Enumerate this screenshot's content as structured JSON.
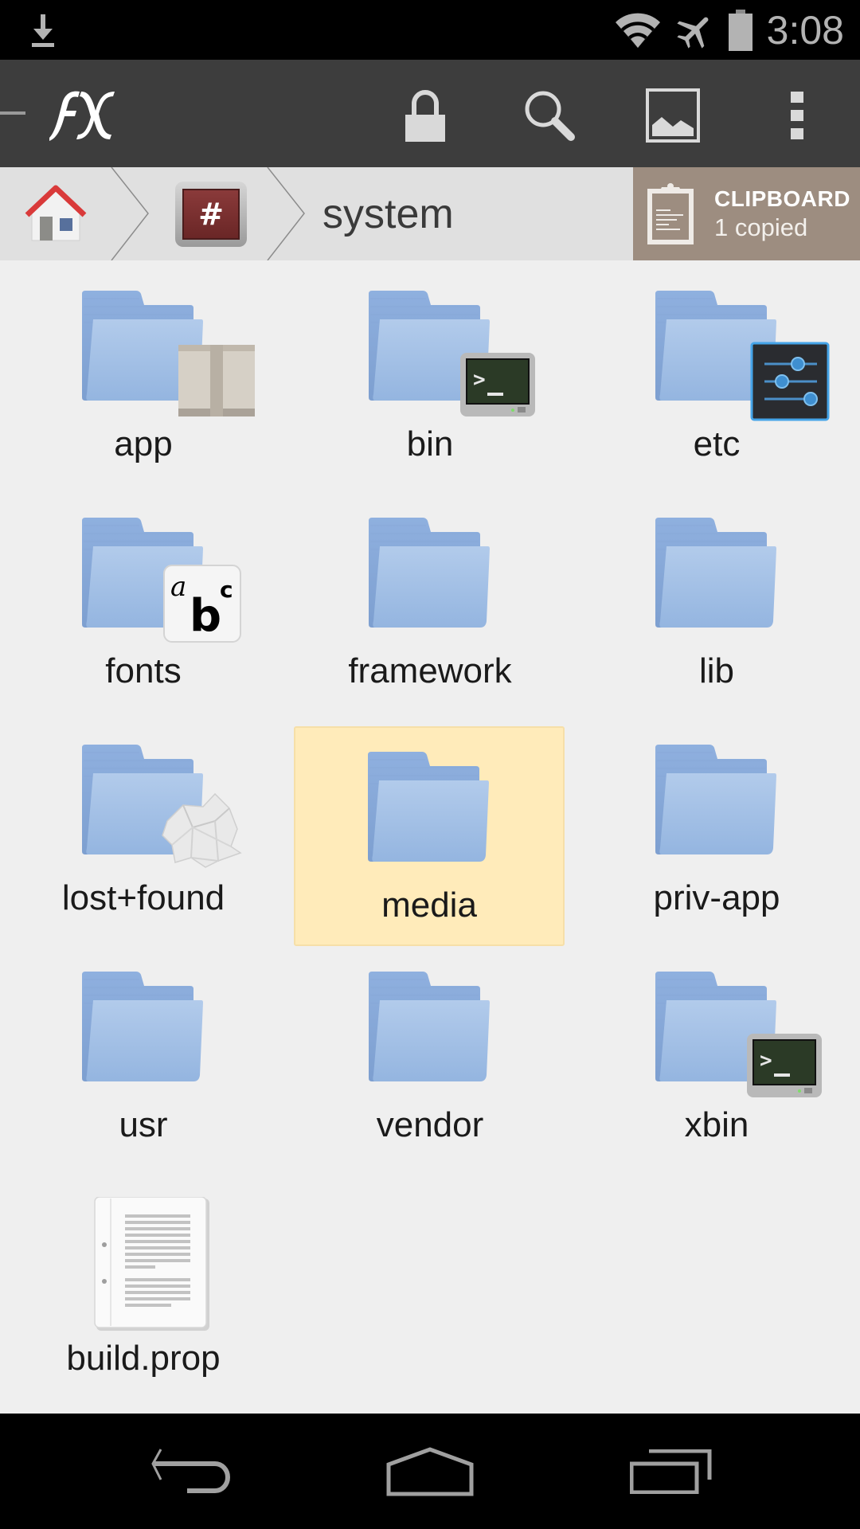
{
  "status_bar": {
    "time": "3:08",
    "icons": [
      "download-icon",
      "wifi-icon",
      "airplane-mode-icon",
      "battery-icon"
    ]
  },
  "action_bar": {
    "app_logo": "FX",
    "actions": [
      {
        "name": "lock",
        "icon": "lock-icon"
      },
      {
        "name": "search",
        "icon": "search-icon"
      },
      {
        "name": "gallery",
        "icon": "image-icon"
      },
      {
        "name": "overflow",
        "icon": "more-vertical-icon"
      }
    ]
  },
  "breadcrumb": {
    "items": [
      {
        "label": "home",
        "icon": "home-icon"
      },
      {
        "label": "root",
        "icon": "root-hash-icon",
        "glyph": "#"
      },
      {
        "label": "system"
      }
    ]
  },
  "clipboard": {
    "title": "CLIPBOARD",
    "subtitle": "1 copied"
  },
  "files": [
    {
      "name": "app",
      "type": "folder",
      "badge": "package"
    },
    {
      "name": "bin",
      "type": "folder",
      "badge": "terminal"
    },
    {
      "name": "etc",
      "type": "folder",
      "badge": "settings"
    },
    {
      "name": "fonts",
      "type": "folder",
      "badge": "fonts"
    },
    {
      "name": "framework",
      "type": "folder",
      "badge": ""
    },
    {
      "name": "lib",
      "type": "folder",
      "badge": ""
    },
    {
      "name": "lost+found",
      "type": "folder",
      "badge": "crumpled-paper"
    },
    {
      "name": "media",
      "type": "folder",
      "badge": "",
      "selected": true
    },
    {
      "name": "priv-app",
      "type": "folder",
      "badge": ""
    },
    {
      "name": "usr",
      "type": "folder",
      "badge": ""
    },
    {
      "name": "vendor",
      "type": "folder",
      "badge": ""
    },
    {
      "name": "xbin",
      "type": "folder",
      "badge": "terminal"
    },
    {
      "name": "build.prop",
      "type": "file",
      "badge": ""
    }
  ],
  "nav_bar": {
    "buttons": [
      "back",
      "home",
      "recents"
    ]
  },
  "colors": {
    "status_bar": "#000000",
    "action_bar": "#3d3d3d",
    "breadcrumb_bg": "#e0e0e0",
    "clipboard_bg": "#9d8d80",
    "content_bg": "#efefef",
    "selection": "#ffebba",
    "folder": "#9dbde6"
  }
}
